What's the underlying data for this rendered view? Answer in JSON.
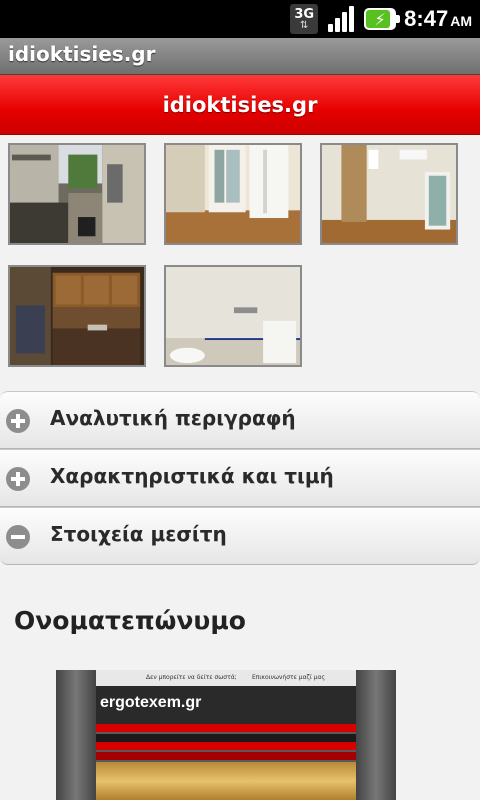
{
  "status_bar": {
    "network": "3G",
    "time": "8:47",
    "ampm": "AM"
  },
  "app": {
    "title": "idioktisies.gr"
  },
  "header": {
    "title": "idioktisies.gr"
  },
  "gallery": {
    "photos": [
      {
        "name": "photo-1"
      },
      {
        "name": "photo-2"
      },
      {
        "name": "photo-3"
      },
      {
        "name": "photo-4"
      },
      {
        "name": "photo-5"
      }
    ]
  },
  "collapsibles": [
    {
      "label": "Αναλυτική περιγραφή",
      "state": "collapsed",
      "icon": "plus-icon"
    },
    {
      "label": "Χαρακτηριστικά και τιμή",
      "state": "collapsed",
      "icon": "plus-icon"
    },
    {
      "label": "Στοιχεία μεσίτη",
      "state": "expanded",
      "icon": "minus-icon"
    }
  ],
  "agent": {
    "name_heading": "Ονοματεπώνυμο",
    "website_preview": {
      "logo": "ergotexem.gr",
      "top_text_left": "Δεν μπορείτε να δείτε σωστά;",
      "top_text_right": "Επικοινωνήστε μαζί μας"
    }
  },
  "colors": {
    "accent_red": "#e60000",
    "title_bar": "#7f7f7f",
    "status_bar": "#000000"
  }
}
